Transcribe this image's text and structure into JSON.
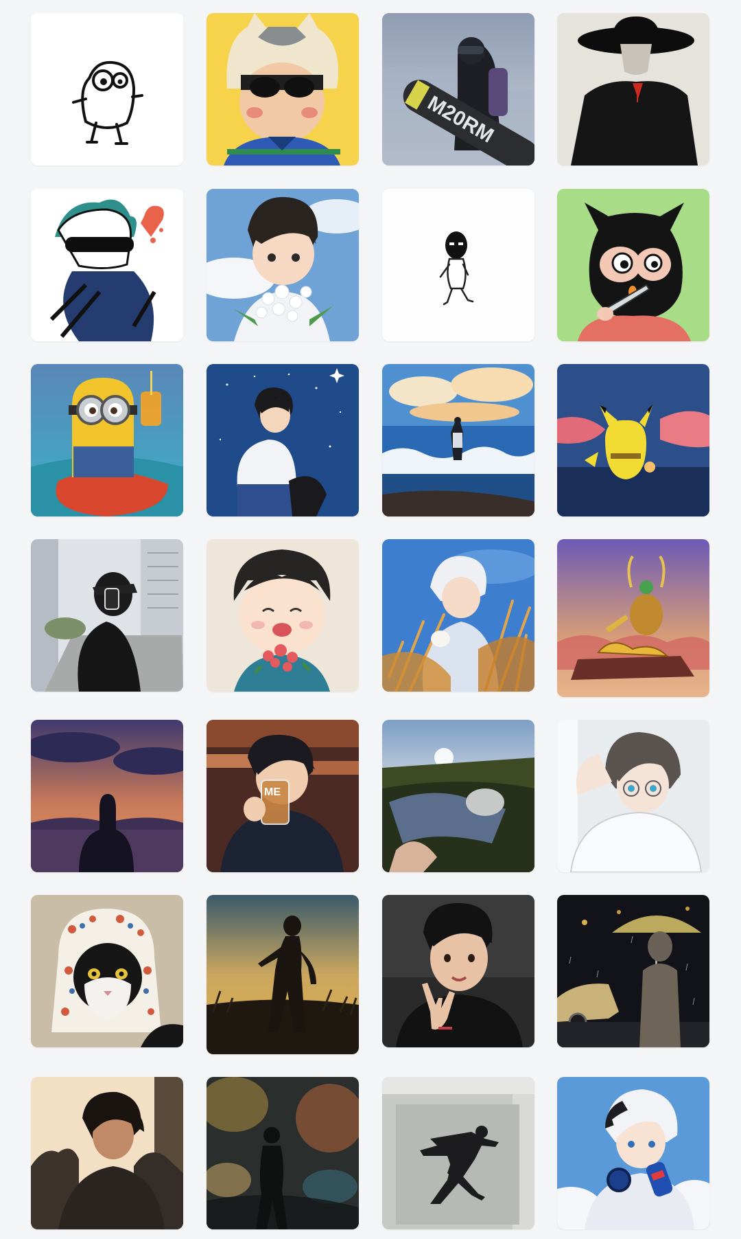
{
  "gallery": {
    "tiles": [
      {
        "icon": "doodle-bird-icon"
      },
      {
        "icon": "boy-wolf-hat-icon"
      },
      {
        "icon": "snowboarder-photo-icon"
      },
      {
        "icon": "hat-figure-ink-icon"
      },
      {
        "icon": "ink-boy-heart-icon"
      },
      {
        "icon": "boy-flowers-sky-icon"
      },
      {
        "icon": "masked-stick-figure-icon"
      },
      {
        "icon": "masked-character-knife-icon"
      },
      {
        "icon": "minion-drink-icon"
      },
      {
        "icon": "boy-starry-sky-icon"
      },
      {
        "icon": "ocean-waves-figure-icon"
      },
      {
        "icon": "pikachu-sunset-icon"
      },
      {
        "icon": "masked-man-city-icon"
      },
      {
        "icon": "smiling-boy-roses-icon"
      },
      {
        "icon": "boy-wheat-field-icon"
      },
      {
        "icon": "golden-crown-sunset-icon"
      },
      {
        "icon": "silhouette-sunset-sea-icon"
      },
      {
        "icon": "boy-drinking-icon"
      },
      {
        "icon": "lying-field-photo-icon"
      },
      {
        "icon": "glasses-boy-white-hoodie-icon"
      },
      {
        "icon": "cat-floral-hood-icon"
      },
      {
        "icon": "silhouette-golden-field-icon"
      },
      {
        "icon": "boy-hand-sign-icon"
      },
      {
        "icon": "umbrella-night-rain-icon"
      },
      {
        "icon": "anime-boy-backlit-icon"
      },
      {
        "icon": "blurry-night-figure-icon"
      },
      {
        "icon": "man-lying-floor-icon"
      },
      {
        "icon": "white-hair-boy-soda-icon"
      }
    ]
  }
}
